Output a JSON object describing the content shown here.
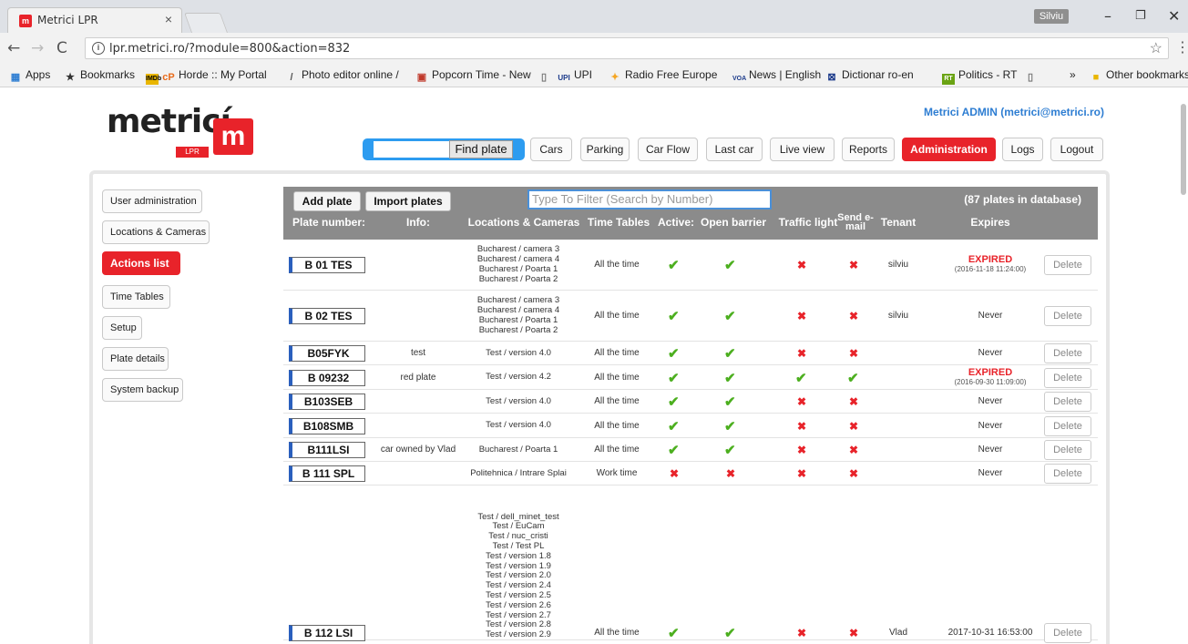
{
  "browser": {
    "tab_title": "Metrici LPR",
    "profile": "Silviu",
    "url": "lpr.metrici.ro/?module=800&action=832",
    "bookmarks": [
      "Apps",
      "Bookmarks",
      "Horde :: My Portal",
      "Photo editor online /",
      "Popcorn Time - New",
      "",
      "UPI",
      "Radio Free Europe",
      "News | English",
      "Dictionar ro-en",
      "Politics - RT",
      "",
      "»",
      "Other bookmarks"
    ]
  },
  "header": {
    "logo": "metricí",
    "logo_sub": "LPR",
    "user": "Metrici ADMIN (metrici@metrici.ro)",
    "find_label": "Find plate",
    "nav": [
      "Cars",
      "Parking",
      "Car Flow",
      "Last car",
      "Live view",
      "Reports",
      "Administration",
      "Logs",
      "Logout"
    ],
    "active_nav": "Administration"
  },
  "sidebar": {
    "items": [
      "User administration",
      "Locations & Cameras",
      "Actions list",
      "Time Tables",
      "Setup",
      "Plate details",
      "System backup"
    ],
    "active": "Actions list"
  },
  "table": {
    "add_label": "Add plate",
    "import_label": "Import plates",
    "filter_placeholder": "Type To Filter (Search by Number)",
    "count": "(87 plates in database)",
    "columns": [
      "Plate number:",
      "Info:",
      "Locations & Cameras",
      "Time Tables",
      "Active:",
      "Open barrier",
      "Traffic light",
      "Send e-mail",
      "Tenant",
      "Expires"
    ],
    "delete_label": "Delete",
    "rows": [
      {
        "plate": "B 01 TES",
        "info": "",
        "locations": [
          "Bucharest / camera 3",
          "Bucharest / camera 4",
          "Bucharest / Poarta 1",
          "Bucharest / Poarta 2"
        ],
        "time": "All the time",
        "active": true,
        "barrier": true,
        "traffic": false,
        "email": false,
        "tenant": "silviu",
        "expires": "EXPIRED",
        "expires_date": "(2016-11-18 11:24:00)"
      },
      {
        "plate": "B 02 TES",
        "info": "",
        "locations": [
          "Bucharest / camera 3",
          "Bucharest / camera 4",
          "Bucharest / Poarta 1",
          "Bucharest / Poarta 2"
        ],
        "time": "All the time",
        "active": true,
        "barrier": true,
        "traffic": false,
        "email": false,
        "tenant": "silviu",
        "expires": "Never",
        "expires_date": ""
      },
      {
        "plate": "B05FYK",
        "info": "test",
        "locations": [
          "Test / version 4.0"
        ],
        "time": "All the time",
        "active": true,
        "barrier": true,
        "traffic": false,
        "email": false,
        "tenant": "",
        "expires": "Never",
        "expires_date": ""
      },
      {
        "plate": "B 09232",
        "info": "red plate",
        "locations": [
          "Test / version 4.2"
        ],
        "time": "All the time",
        "active": true,
        "barrier": true,
        "traffic": true,
        "email": true,
        "tenant": "",
        "expires": "EXPIRED",
        "expires_date": "(2016-09-30 11:09:00)"
      },
      {
        "plate": "B103SEB",
        "info": "",
        "locations": [
          "Test / version 4.0"
        ],
        "time": "All the time",
        "active": true,
        "barrier": true,
        "traffic": false,
        "email": false,
        "tenant": "",
        "expires": "Never",
        "expires_date": ""
      },
      {
        "plate": "B108SMB",
        "info": "",
        "locations": [
          "Test / version 4.0"
        ],
        "time": "All the time",
        "active": true,
        "barrier": true,
        "traffic": false,
        "email": false,
        "tenant": "",
        "expires": "Never",
        "expires_date": ""
      },
      {
        "plate": "B111LSI",
        "info": "car owned by Vlad",
        "locations": [
          "Bucharest / Poarta 1"
        ],
        "time": "All the time",
        "active": true,
        "barrier": true,
        "traffic": false,
        "email": false,
        "tenant": "",
        "expires": "Never",
        "expires_date": ""
      },
      {
        "plate": "B 111 SPL",
        "info": "",
        "locations": [
          "Politehnica / Intrare Splai"
        ],
        "time": "Work time",
        "active": false,
        "barrier": false,
        "traffic": false,
        "email": false,
        "tenant": "",
        "expires": "Never",
        "expires_date": ""
      },
      {
        "plate": "B 112 LSI",
        "info": "",
        "locations": [
          "Test / dell_minet_test",
          "Test / EuCam",
          "Test / nuc_cristi",
          "Test / Test PL",
          "Test / version 1.8",
          "Test / version 1.9",
          "Test / version 2.0",
          "Test / version 2.4",
          "Test / version 2.5",
          "Test / version 2.6",
          "Test / version 2.7",
          "Test / version 2.8",
          "Test / version 2.9"
        ],
        "time": "All the time",
        "active": true,
        "barrier": true,
        "traffic": false,
        "email": false,
        "tenant": "Vlad",
        "expires": "2017-10-31 16:53:00",
        "expires_date": ""
      }
    ]
  }
}
